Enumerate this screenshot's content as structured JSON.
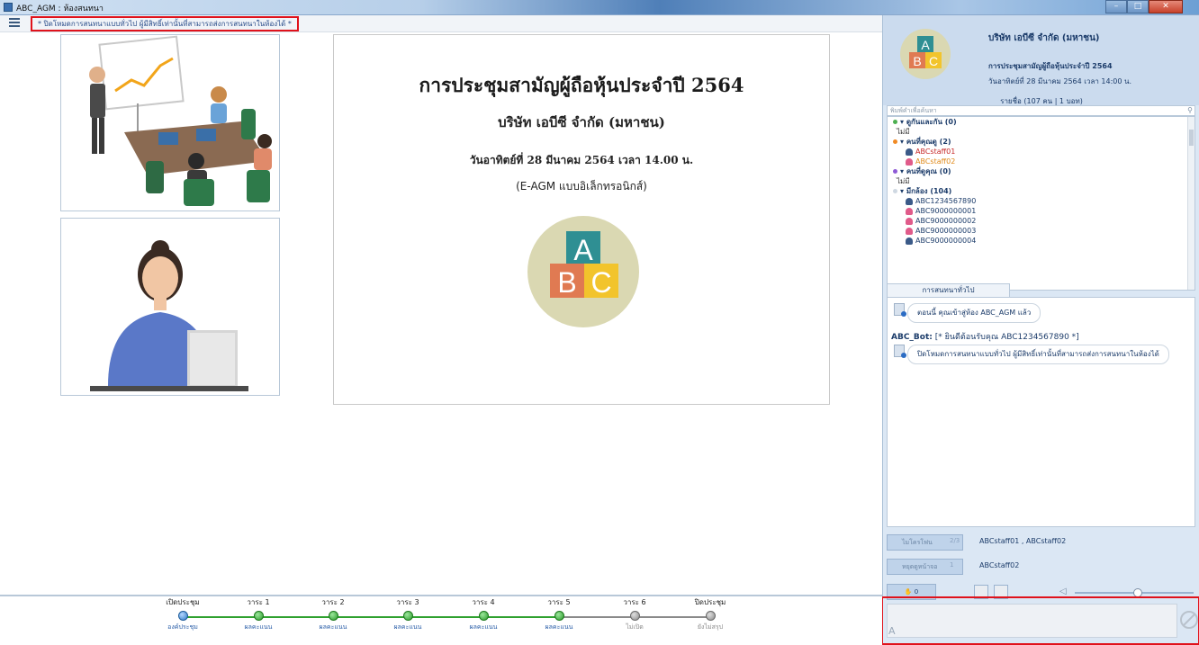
{
  "window": {
    "title": "ABC_AGM : ห้องสนทนา",
    "minimize": "–",
    "maximize": "□",
    "close": "✕"
  },
  "toolbar": {
    "notice": "* ปิดโหมดการสนทนาแบบทั่วไป ผู้มีสิทธิ์เท่านั้นที่สามารถส่งการสนทนาในห้องได้ *"
  },
  "slide": {
    "title": "การประชุมสามัญผู้ถือหุ้นประจำปี 2564",
    "company": "บริษัท เอบีซี จำกัด (มหาชน)",
    "date": "วันอาทิตย์ที่ 28 มีนาคม 2564 เวลา 14.00 น.",
    "mode": "(E-AGM แบบอิเล็กทรอนิกส์)",
    "logo_letters": [
      "A",
      "B",
      "C"
    ]
  },
  "header": {
    "company": "บริษัท เอบีซี จำกัด (มหาชน)",
    "meeting_title": "การประชุมสามัญผู้ถือหุ้นประจำปี 2564",
    "meeting_date": "วันอาทิตย์ที่ 28 มีนาคม 2564 เวลา 14:00 น.",
    "participant_count": "รายชื่อ (107 คน | 1 บอท)"
  },
  "search": {
    "placeholder": "พิมพ์คำเพื่อค้นหา"
  },
  "tree": {
    "groups": [
      {
        "label": "ดูกันและกัน (0)",
        "color": "#4caf50",
        "empty": "ไม่มี",
        "users": []
      },
      {
        "label": "คนที่คุณดู (2)",
        "color": "#f08a24",
        "empty": "",
        "users": [
          {
            "name": "ABCstaff01",
            "style": "red"
          },
          {
            "name": "ABCstaff02",
            "style": "orange"
          }
        ]
      },
      {
        "label": "คนที่ดูคุณ (0)",
        "color": "#8e5ad6",
        "empty": "ไม่มี",
        "users": []
      },
      {
        "label": "มีกล้อง (104)",
        "color": "#cfd8e2",
        "empty": "",
        "users": [
          {
            "name": "ABC1234567890",
            "style": "dark"
          },
          {
            "name": "ABC9000000001",
            "style": "pink"
          },
          {
            "name": "ABC9000000002",
            "style": "pink"
          },
          {
            "name": "ABC9000000003",
            "style": "pink"
          },
          {
            "name": "ABC9000000004",
            "style": "dark"
          }
        ]
      }
    ]
  },
  "chat": {
    "tab": "การสนทนาทั่วไป",
    "msg1": "ตอนนี้ คุณเข้าสู่ห้อง ABC_AGM แล้ว",
    "msg2_sender": "ABC_Bot:",
    "msg2_text": "[* ยินดีต้อนรับคุณ ABC1234567890 *]",
    "msg3": "ปิดโหมดการสนทนาแบบทั่วไป ผู้มีสิทธิ์เท่านั้นที่สามารถส่งการสนทนาในห้องได้"
  },
  "controls": {
    "mic_label": "ไมโครโฟน",
    "mic_count": "2/3",
    "mic_users": "ABCstaff01 , ABCstaff02",
    "screen_label": "หยุดดูหน้าจอ",
    "screen_count": "1",
    "screen_users": "ABCstaff02",
    "hand_count": "0"
  },
  "timeline": [
    {
      "name": "เปิดประชุม",
      "status": "องค์ประชุม",
      "state": "current"
    },
    {
      "name": "วาระ 1",
      "status": "ผลคะแนน",
      "state": "done"
    },
    {
      "name": "วาระ 2",
      "status": "ผลคะแนน",
      "state": "done"
    },
    {
      "name": "วาระ 3",
      "status": "ผลคะแนน",
      "state": "done"
    },
    {
      "name": "วาระ 4",
      "status": "ผลคะแนน",
      "state": "done"
    },
    {
      "name": "วาระ 5",
      "status": "ผลคะแนน",
      "state": "done"
    },
    {
      "name": "วาระ 6",
      "status": "ไม่เปิด",
      "state": "pending"
    },
    {
      "name": "ปิดประชุม",
      "status": "ยังไม่สรุป",
      "state": "pending"
    }
  ]
}
